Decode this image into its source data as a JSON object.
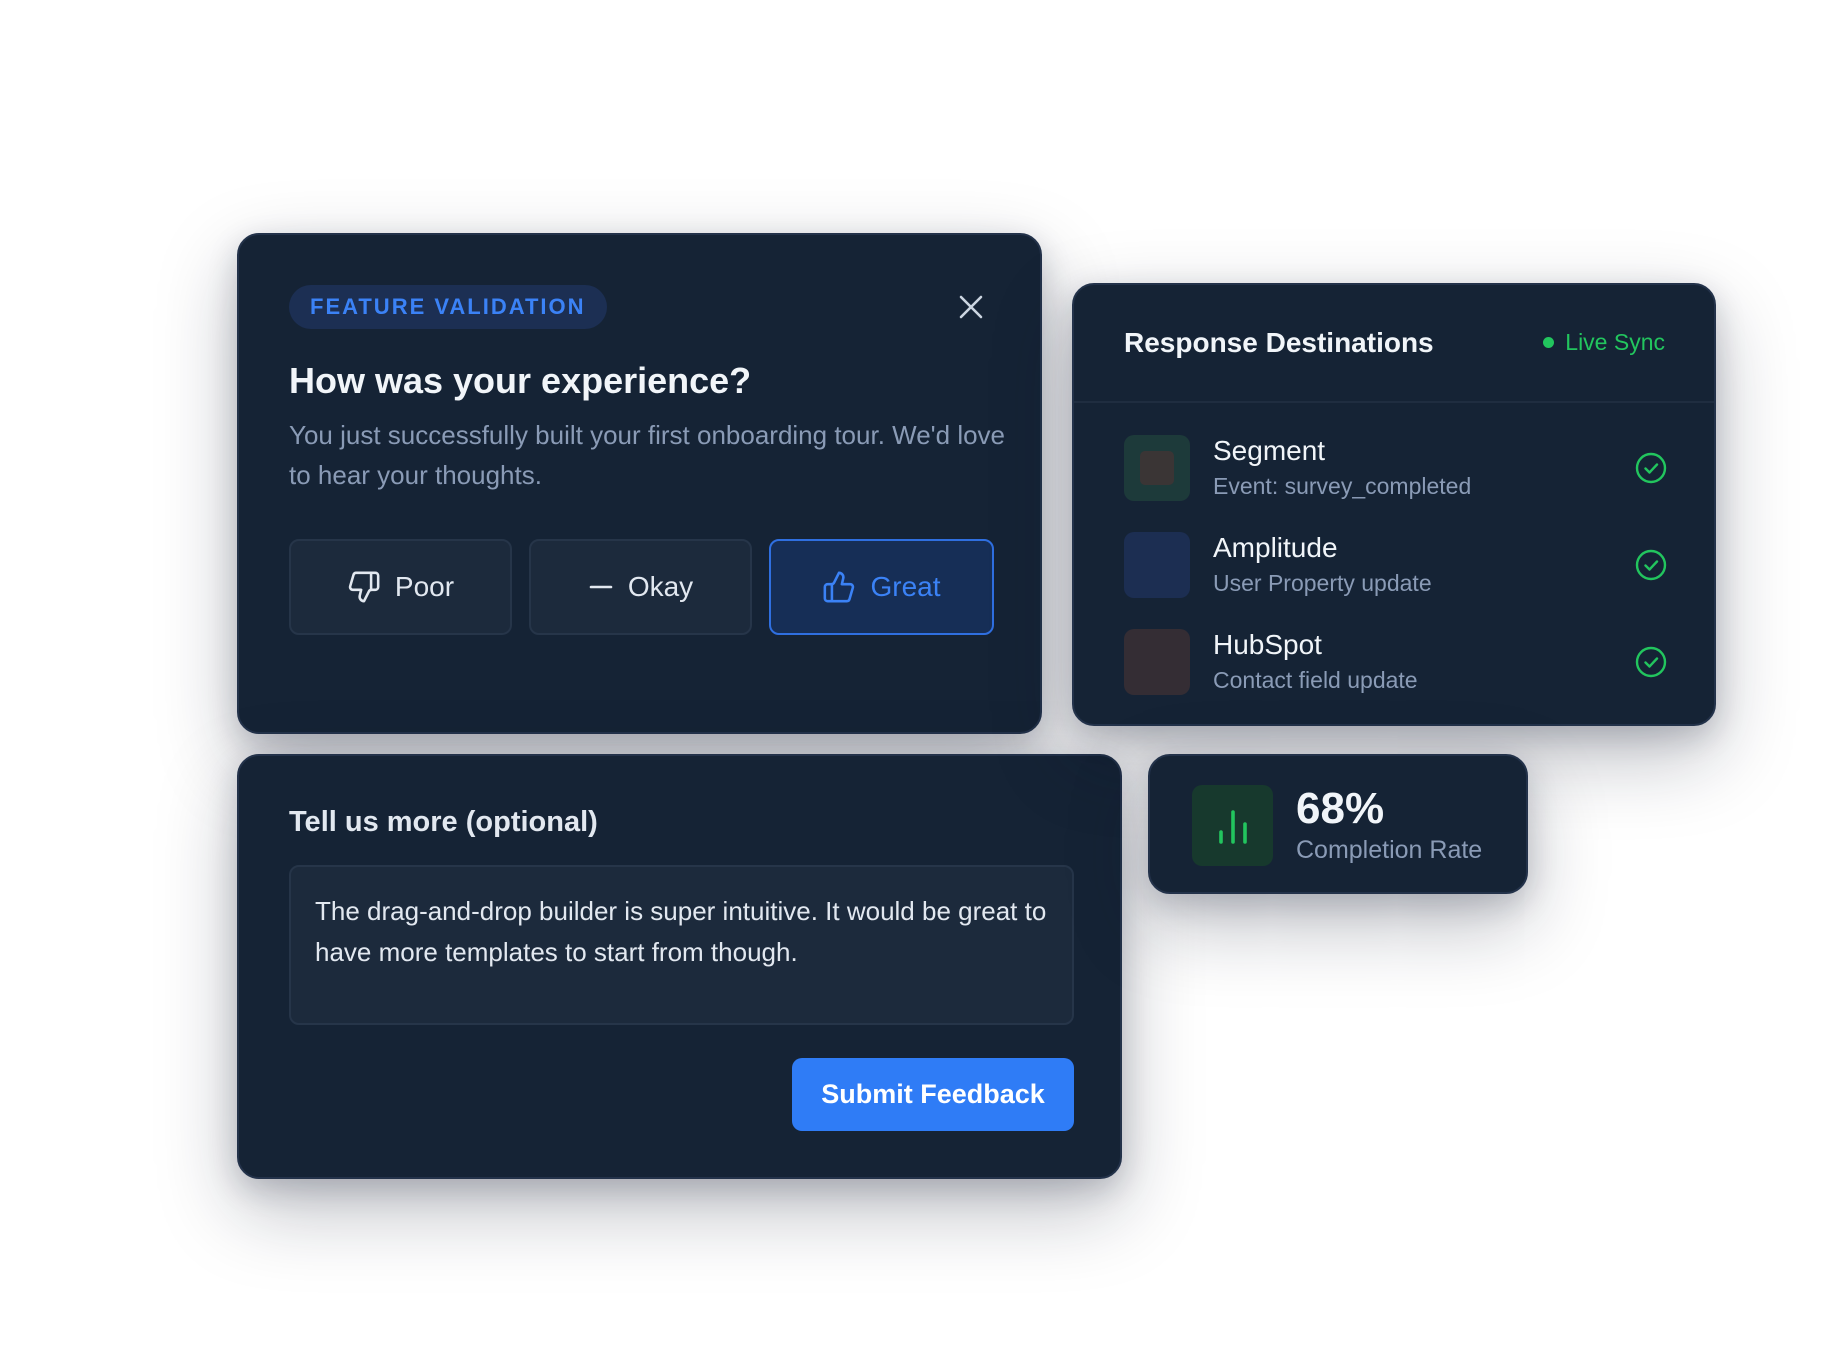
{
  "colors": {
    "accent": "#2f7cf6",
    "success": "#22c55e",
    "card_background": "#152335",
    "muted_text": "#8a9bb6"
  },
  "survey": {
    "badge": "FEATURE VALIDATION",
    "title": "How was your experience?",
    "description": "You just successfully built your first onboarding tour. We'd love to hear your thoughts.",
    "close_icon": "close-icon",
    "ratings": [
      {
        "label": "Poor",
        "icon": "thumbs-down-icon",
        "selected": false
      },
      {
        "label": "Okay",
        "icon": "minus-icon",
        "selected": false
      },
      {
        "label": "Great",
        "icon": "thumbs-up-icon",
        "selected": true
      }
    ]
  },
  "feedback": {
    "label": "Tell us more (optional)",
    "text": "The drag-and-drop builder is super intuitive. It would be great to have more templates to start from though.",
    "submit_label": "Submit Feedback"
  },
  "destinations": {
    "title": "Response Destinations",
    "status": "Live Sync",
    "items": [
      {
        "name": "Segment",
        "detail": "Event: survey_completed",
        "status_icon": "check-circle-icon"
      },
      {
        "name": "Amplitude",
        "detail": "User Property update",
        "status_icon": "check-circle-icon"
      },
      {
        "name": "HubSpot",
        "detail": "Contact field update",
        "status_icon": "check-circle-icon"
      }
    ]
  },
  "stat": {
    "value": "68%",
    "label": "Completion Rate",
    "icon": "bar-chart-icon"
  }
}
